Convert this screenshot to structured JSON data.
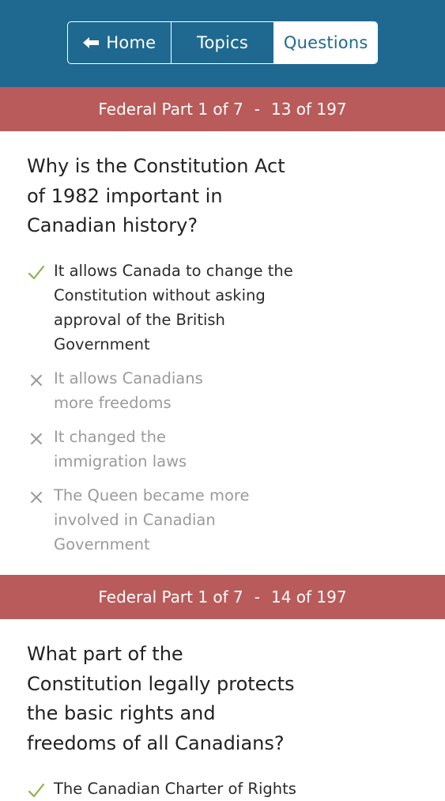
{
  "nav": {
    "home_label": "Home",
    "topics_label": "Topics",
    "questions_label": "Questions"
  },
  "colors": {
    "nav_bar": "#1f6991",
    "section_header": "#b95b5a",
    "correct_mark": "#8ab34a",
    "wrong_mark": "#9a9a9a"
  },
  "questions": [
    {
      "section": "Federal Part 1 of 7",
      "separator": "-",
      "progress": "13 of 197",
      "title_lines": [
        "Why is the Constitution Act",
        "of 1982 important in",
        "Canadian history?"
      ],
      "answers": [
        {
          "lines": [
            "It allows Canada to change the",
            "Constitution without asking",
            "approval of the British",
            "Government"
          ],
          "correct": true,
          "icon": "check-icon"
        },
        {
          "lines": [
            "It allows Canadians",
            "more freedoms"
          ],
          "correct": false,
          "icon": "cross-icon"
        },
        {
          "lines": [
            "It changed the",
            "immigration laws"
          ],
          "correct": false,
          "icon": "cross-icon"
        },
        {
          "lines": [
            "The Queen became more",
            "involved in Canadian",
            "Government"
          ],
          "correct": false,
          "icon": "cross-icon"
        }
      ]
    },
    {
      "section": "Federal Part 1 of 7",
      "separator": "-",
      "progress": "14 of 197",
      "title_lines": [
        "What part of the",
        "Constitution legally protects",
        "the basic rights and",
        "freedoms of all Canadians?"
      ],
      "answers": [
        {
          "lines": [
            "The Canadian Charter of Rights"
          ],
          "correct": true,
          "icon": "check-icon"
        }
      ]
    }
  ]
}
